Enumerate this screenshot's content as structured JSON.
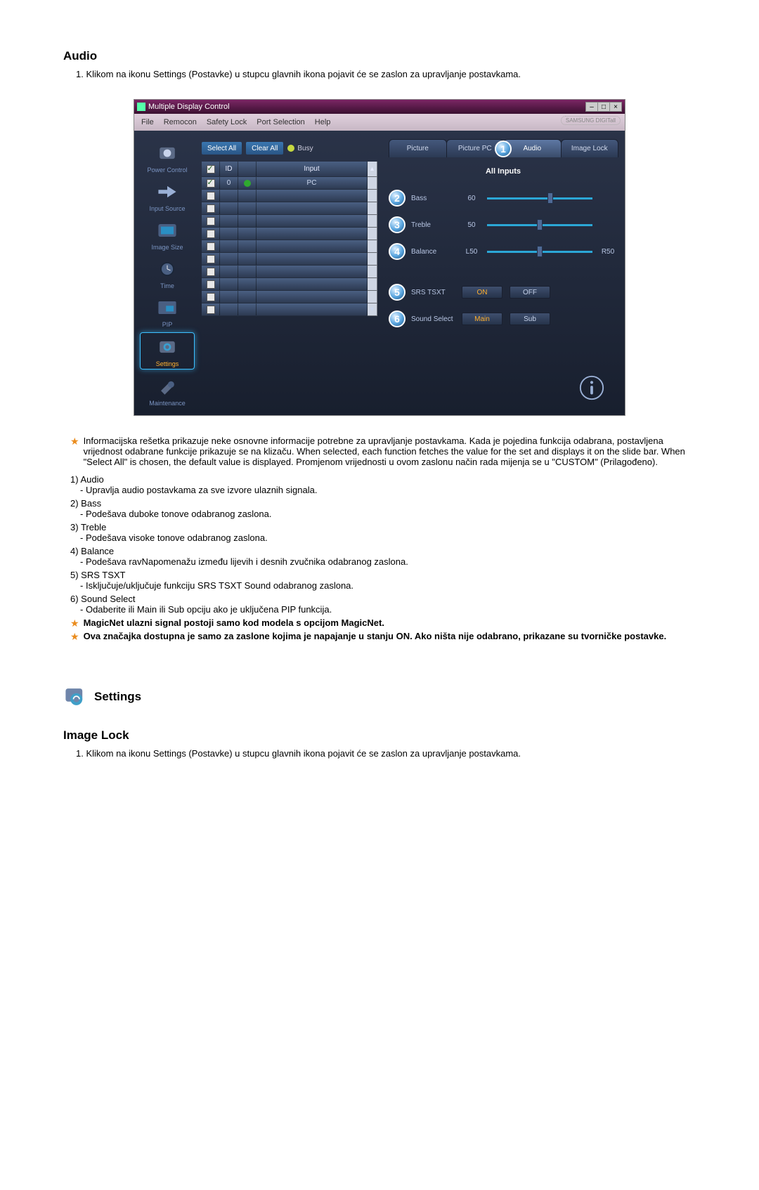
{
  "audio_section": {
    "title": "Audio",
    "instruction": "Klikom na ikonu Settings (Postavke) u stupcu glavnih ikona pojavit će se zaslon za upravljanje postavkama."
  },
  "app": {
    "title": "Multiple Display Control",
    "menus": [
      "File",
      "Remocon",
      "Safety Lock",
      "Port Selection",
      "Help"
    ],
    "brand": "SAMSUNG DIGITall",
    "sidebar": [
      {
        "label": "Power Control"
      },
      {
        "label": "Input Source"
      },
      {
        "label": "Image Size"
      },
      {
        "label": "Time"
      },
      {
        "label": "PIP"
      },
      {
        "label": "Settings"
      },
      {
        "label": "Maintenance"
      }
    ],
    "center": {
      "select_all": "Select All",
      "clear_all": "Clear All",
      "busy": "Busy",
      "header": {
        "col1": "☑",
        "col2": "ID",
        "col3": "",
        "col4": "Input"
      },
      "row0": {
        "id": "0",
        "input": "PC"
      }
    },
    "tabs": [
      "Picture",
      "Picture PC",
      "Audio",
      "Image Lock"
    ],
    "sub_header": "All Inputs",
    "controls": {
      "bass": {
        "label": "Bass",
        "value": "60"
      },
      "treble": {
        "label": "Treble",
        "value": "50"
      },
      "balance": {
        "label": "Balance",
        "left": "L50",
        "right": "R50"
      },
      "srs": {
        "label": "SRS TSXT",
        "on": "ON",
        "off": "OFF"
      },
      "sound_select": {
        "label": "Sound Select",
        "main": "Main",
        "sub": "Sub"
      }
    },
    "bubbles": {
      "tab": "1",
      "bass": "2",
      "treble": "3",
      "balance": "4",
      "srs": "5",
      "sound_select": "6"
    }
  },
  "notes": {
    "info_grid": "Informacijska rešetka prikazuje neke osnovne informacije potrebne za upravljanje postavkama. Kada je pojedina funkcija odabrana, postavljena vrijednost odabrane funkcije prikazuje se na klizaču. When selected, each function fetches the value for the set and displays it on the slide bar. When \"Select All\" is chosen, the default value is displayed. Promjenom vrijednosti u ovom zaslonu način rada mijenja se u \"CUSTOM\" (Prilagođeno)."
  },
  "num_items": [
    {
      "n": "1",
      "head": "Audio",
      "detail": "Upravlja audio postavkama za sve izvore ulaznih signala."
    },
    {
      "n": "2",
      "head": "Bass",
      "detail": "Podešava duboke tonove odabranog zaslona."
    },
    {
      "n": "3",
      "head": "Treble",
      "detail": "Podešava visoke tonove odabranog zaslona."
    },
    {
      "n": "4",
      "head": "Balance",
      "detail": "Podešava ravNapomenažu između lijevih i desnih zvučnika odabranog zaslona."
    },
    {
      "n": "5",
      "head": "SRS TSXT",
      "detail": "Isključuje/uključuje funkciju SRS TSXT Sound odabranog zaslona."
    },
    {
      "n": "6",
      "head": "Sound Select",
      "detail": "Odaberite ili Main ili Sub opciju ako je uključena PIP funkcija."
    }
  ],
  "star_notes": {
    "magicnet": "MagicNet ulazni signal postoji samo kod modela s opcijom MagicNet.",
    "power_on": "Ova značajka dostupna je samo za zaslone kojima je napajanje u stanju ON. Ako ništa nije odabrano, prikazane su tvorničke postavke."
  },
  "settings_section": {
    "title": "Settings",
    "subtitle": "Image Lock",
    "instruction": "Klikom na ikonu Settings (Postavke) u stupcu glavnih ikona pojavit će se zaslon za upravljanje postavkama."
  },
  "chart_data": {
    "type": "table",
    "title": "Audio settings sliders",
    "rows": [
      {
        "control": "Bass",
        "value": 60,
        "range": [
          0,
          100
        ]
      },
      {
        "control": "Treble",
        "value": 50,
        "range": [
          0,
          100
        ]
      },
      {
        "control": "Balance",
        "value": 50,
        "range": [
          0,
          100
        ],
        "note": "L50 / R50"
      }
    ],
    "toggles": [
      {
        "control": "SRS TSXT",
        "options": [
          "ON",
          "OFF"
        ],
        "selected": "ON"
      },
      {
        "control": "Sound Select",
        "options": [
          "Main",
          "Sub"
        ],
        "selected": "Main"
      }
    ]
  }
}
